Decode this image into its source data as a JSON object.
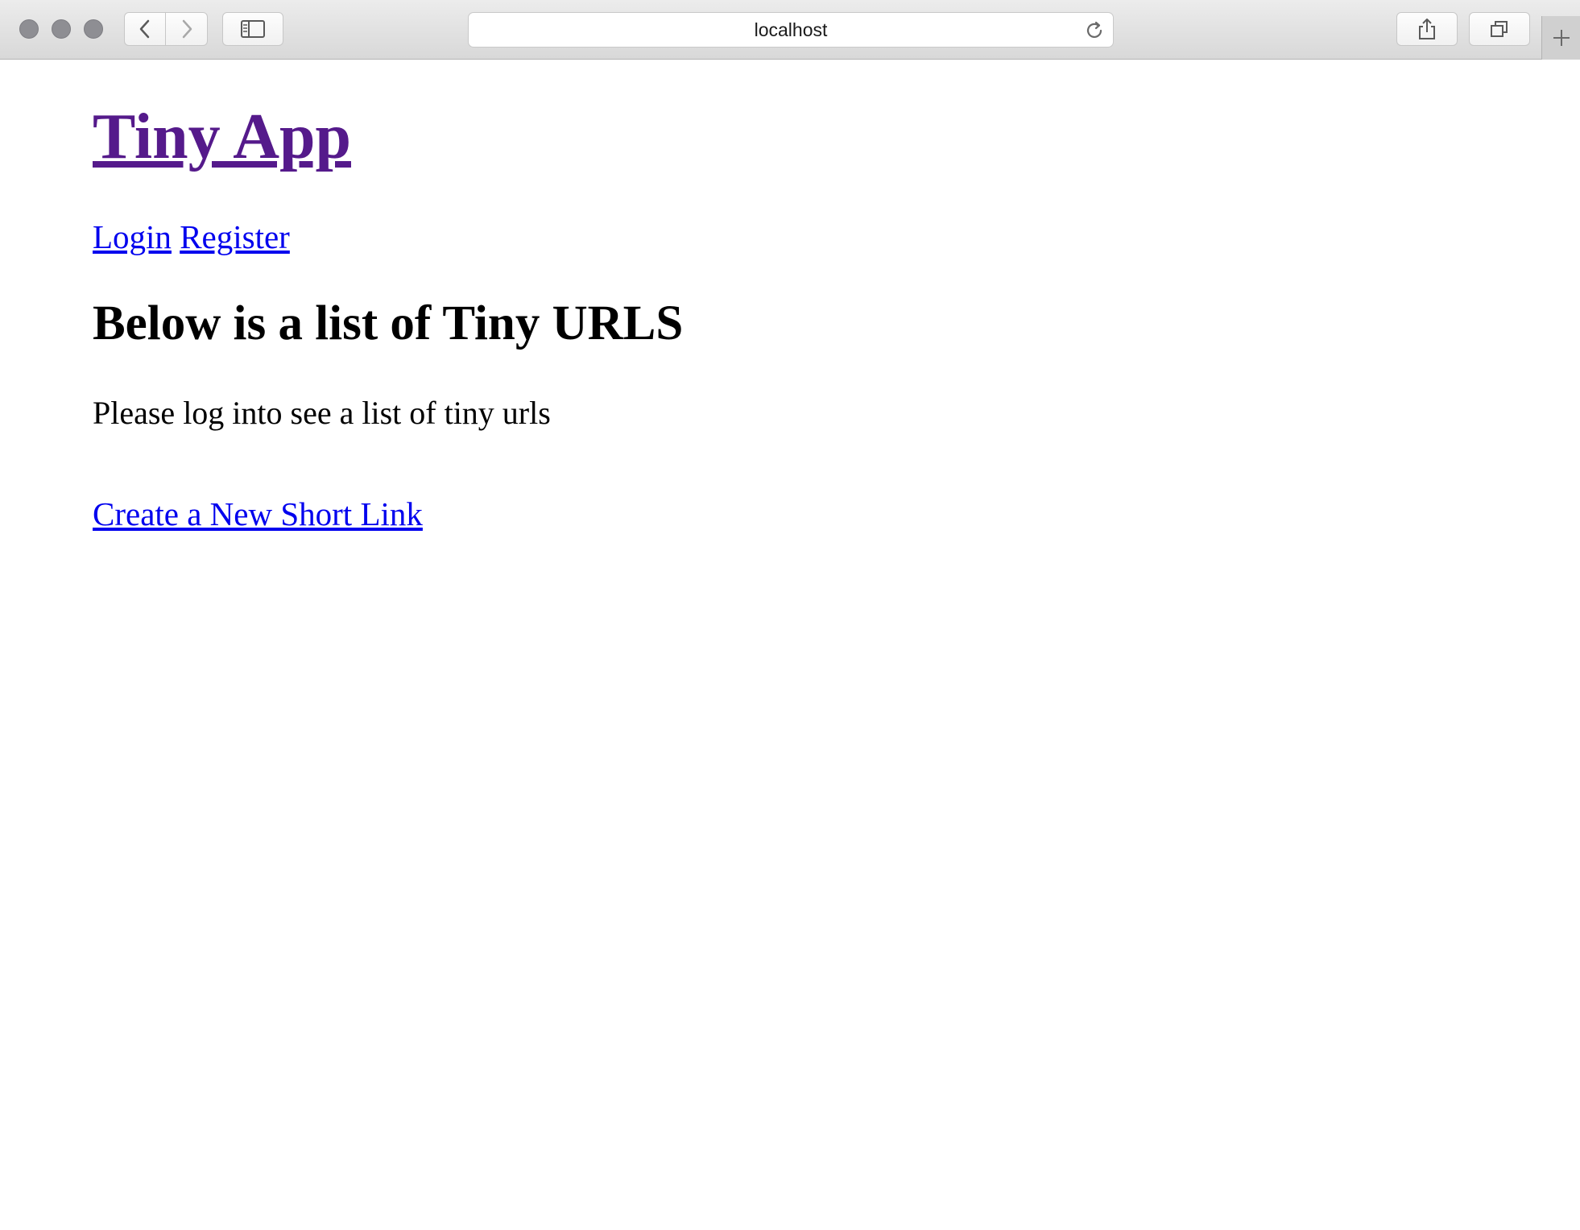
{
  "browser": {
    "address": "localhost",
    "icons": {
      "back": "chevron-left-icon",
      "forward": "chevron-right-icon",
      "sidebar": "sidebar-icon",
      "reload": "reload-icon",
      "share": "share-icon",
      "tabs": "tabs-overview-icon",
      "new_tab": "plus-icon"
    }
  },
  "page": {
    "title_link": "Tiny App",
    "nav": {
      "login": "Login",
      "register": "Register"
    },
    "heading": "Below is a list of Tiny URLS",
    "notice": "Please log into see a list of tiny urls",
    "create_link": "Create a New Short Link"
  },
  "colors": {
    "visited_link": "#551a8b",
    "link": "#0000ee",
    "text": "#000000"
  }
}
